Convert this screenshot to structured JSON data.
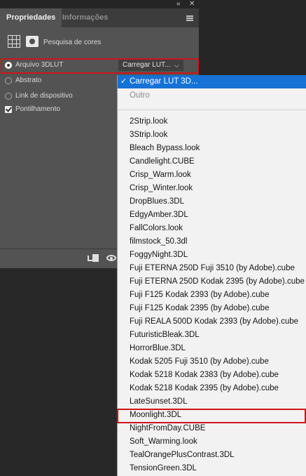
{
  "panel": {
    "tabs": [
      "Propriedades",
      "Informações"
    ],
    "chrome_left": "«",
    "chrome_close": "✕",
    "heading": "Pesquisa de cores",
    "options": {
      "arquivo": "Arquivo 3DLUT",
      "abstrato": "Abstrato",
      "link": "Link de dispositivo",
      "pontilhamento": "Pontilhamento"
    },
    "lut_select_value": "Carregar LUT..."
  },
  "dropdown": {
    "selected": "Carregar LUT 3D...",
    "disabled": "Outro",
    "items": [
      "2Strip.look",
      "3Strip.look",
      "Bleach Bypass.look",
      "Candlelight.CUBE",
      "Crisp_Warm.look",
      "Crisp_Winter.look",
      "DropBlues.3DL",
      "EdgyAmber.3DL",
      "FallColors.look",
      "filmstock_50.3dl",
      "FoggyNight.3DL",
      "Fuji ETERNA 250D Fuji 3510 (by Adobe).cube",
      "Fuji ETERNA 250D Kodak 2395 (by Adobe).cube",
      "Fuji F125 Kodak 2393 (by Adobe).cube",
      "Fuji F125 Kodak 2395 (by Adobe).cube",
      "Fuji REALA 500D Kodak 2393 (by Adobe).cube",
      "FuturisticBleak.3DL",
      "HorrorBlue.3DL",
      "Kodak 5205 Fuji 3510 (by Adobe).cube",
      "Kodak 5218 Kodak 2383 (by Adobe).cube",
      "Kodak 5218 Kodak 2395 (by Adobe).cube",
      "LateSunset.3DL",
      "Moonlight.3DL",
      "NightFromDay.CUBE",
      "Soft_Warming.look",
      "TealOrangePlusContrast.3DL",
      "TensionGreen.3DL"
    ],
    "highlighted_item": "Moonlight.3DL"
  },
  "colors": {
    "panel_bg": "#535353",
    "selection_blue": "#1672d4",
    "highlight_red": "#d0141b"
  }
}
